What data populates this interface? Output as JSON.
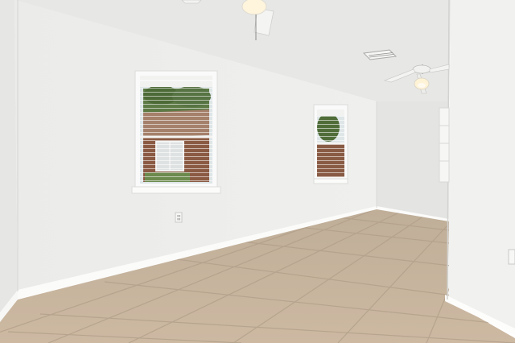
{
  "scene": {
    "subject": "empty-room-interior",
    "colors": {
      "ceiling": "#e9e9e7",
      "wall_left": "#eeeeec",
      "wall_back": "#e6e6e4",
      "wall_right_far": "#e8e8e6",
      "wall_right_near": "#f0f0ee",
      "baseboard": "#fbfbfa",
      "floor_tile": "#c9b8a2",
      "floor_grout": "#b3a18b",
      "window_frame": "#fafafa",
      "blind_slat": "#f3f3f1",
      "sky": "#dfe7ea",
      "foliage": "#4f6b3a",
      "brick": "#8e5c44",
      "roof": "#9a7a66",
      "fan_light": "#fff3d6"
    },
    "icons": [
      "ceiling-fan-icon",
      "air-vent-icon",
      "electrical-outlet-icon"
    ]
  }
}
